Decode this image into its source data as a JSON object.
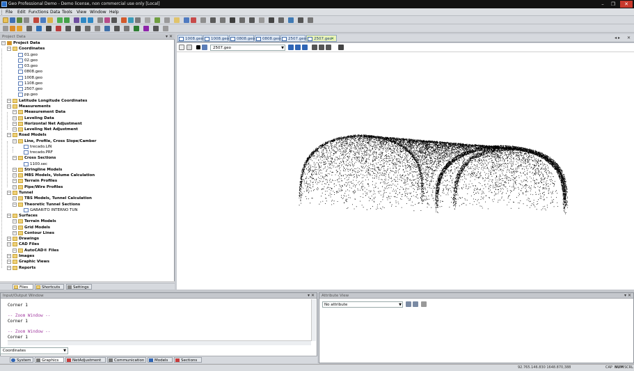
{
  "window": {
    "title": "Geo Professional Demo - Demo license, non commercial use only [Local]",
    "minimize_glyph": "–",
    "restore_glyph": "❐",
    "close_glyph": "✕"
  },
  "menu": [
    "File",
    "Edit",
    "Functions",
    "Data",
    "Tools",
    "View",
    "Window",
    "Help"
  ],
  "project_pane": {
    "title": "Project Data",
    "tree": [
      {
        "label": "Project Data",
        "level": 0,
        "kind": "project",
        "bold": true
      },
      {
        "label": "Coordinates",
        "level": 1,
        "kind": "folder",
        "bold": true
      },
      {
        "label": "01.geo",
        "level": 2,
        "kind": "file"
      },
      {
        "label": "02.geo",
        "level": 2,
        "kind": "file"
      },
      {
        "label": "03.geo",
        "level": 2,
        "kind": "file"
      },
      {
        "label": "0808.geo",
        "level": 2,
        "kind": "file"
      },
      {
        "label": "1008.geo",
        "level": 2,
        "kind": "file"
      },
      {
        "label": "1108.geo",
        "level": 2,
        "kind": "file"
      },
      {
        "label": "2507.geo",
        "level": 2,
        "kind": "file"
      },
      {
        "label": "pp.geo",
        "level": 2,
        "kind": "file"
      },
      {
        "label": "Latitude Longitude Coordinates",
        "level": 1,
        "kind": "folder",
        "bold": true
      },
      {
        "label": "Measurements",
        "level": 1,
        "kind": "folder",
        "bold": true
      },
      {
        "label": "Measurement Data",
        "level": 2,
        "kind": "folder",
        "bold": true
      },
      {
        "label": "Leveling Data",
        "level": 2,
        "kind": "folder",
        "bold": true
      },
      {
        "label": "Horizontal Net Adjustment",
        "level": 2,
        "kind": "folder",
        "bold": true
      },
      {
        "label": "Leveling Net Adjustment",
        "level": 2,
        "kind": "folder",
        "bold": true
      },
      {
        "label": "Road Models",
        "level": 1,
        "kind": "folder",
        "bold": true
      },
      {
        "label": "Line, Profile, Cross Slope/Camber",
        "level": 2,
        "kind": "folder",
        "bold": true
      },
      {
        "label": "trecado.LIN",
        "level": 3,
        "kind": "line"
      },
      {
        "label": "trecado.PRF",
        "level": 3,
        "kind": "profile"
      },
      {
        "label": "Cross Sections",
        "level": 2,
        "kind": "folder",
        "bold": true
      },
      {
        "label": "1100.sec",
        "level": 3,
        "kind": "section"
      },
      {
        "label": "Stringline Models",
        "level": 2,
        "kind": "folder",
        "bold": true
      },
      {
        "label": "MBS Models, Volume Calculation",
        "level": 2,
        "kind": "folder",
        "bold": true
      },
      {
        "label": "Terrain Profiles",
        "level": 2,
        "kind": "folder",
        "bold": true
      },
      {
        "label": "Pipe/Wire Profiles",
        "level": 2,
        "kind": "folder",
        "bold": true
      },
      {
        "label": "Tunnel",
        "level": 1,
        "kind": "folder",
        "bold": true
      },
      {
        "label": "TBS Models, Tunnel Calculation",
        "level": 2,
        "kind": "folder",
        "bold": true
      },
      {
        "label": "Theoretic Tunnel Sections",
        "level": 2,
        "kind": "folder",
        "bold": true
      },
      {
        "label": "GABARITO INTERNO TUN",
        "level": 3,
        "kind": "tunnel"
      },
      {
        "label": "Surfaces",
        "level": 1,
        "kind": "folder",
        "bold": true
      },
      {
        "label": "Terrain Models",
        "level": 2,
        "kind": "folder",
        "bold": true
      },
      {
        "label": "Grid Models",
        "level": 2,
        "kind": "folder",
        "bold": true
      },
      {
        "label": "Contour Lines",
        "level": 2,
        "kind": "folder",
        "bold": true
      },
      {
        "label": "Drawings",
        "level": 1,
        "kind": "folder",
        "bold": true
      },
      {
        "label": "CAD Files",
        "level": 1,
        "kind": "folder",
        "bold": true
      },
      {
        "label": "AutoCAD® Files",
        "level": 2,
        "kind": "folder",
        "bold": true
      },
      {
        "label": "Images",
        "level": 1,
        "kind": "folder",
        "bold": true
      },
      {
        "label": "Graphic Views",
        "level": 1,
        "kind": "folder",
        "bold": true
      },
      {
        "label": "Reports",
        "level": 1,
        "kind": "folder",
        "bold": true
      }
    ],
    "tabs": [
      "Files",
      "Shortcuts",
      "Settings"
    ]
  },
  "doc_tabs": [
    "1008.geo",
    "1008.geo",
    "0808.geo",
    "0808.geo",
    "2507.geo",
    "2507.geo"
  ],
  "graphic_view": {
    "selected_file": "2507.geo"
  },
  "io_window": {
    "title": "Input/Output Window",
    "lines": [
      {
        "text": "Corner 1",
        "kind": "normal"
      },
      {
        "text": "",
        "kind": "normal"
      },
      {
        "text": "-- Zoom Window --",
        "kind": "zoom"
      },
      {
        "text": "Corner 1",
        "kind": "normal"
      },
      {
        "text": "",
        "kind": "normal"
      },
      {
        "text": "-- Zoom Window --",
        "kind": "zoom"
      },
      {
        "text": "Corner 1",
        "kind": "normal"
      }
    ],
    "command_value": "Coordinates",
    "tabs": [
      "System",
      "Graphics",
      "NetAdjustment",
      "Communication",
      "Models",
      "Sections"
    ]
  },
  "attribute_view": {
    "title": "Attribute View",
    "selected": "No attribute"
  },
  "statusbar": {
    "coords": "92.765.146.830   1648.870,388",
    "indicators": [
      "CAP",
      "NUM",
      "SCRL"
    ]
  },
  "colors": {
    "title_bg": "#121212",
    "doc_tab_active": "#eaf4b8",
    "zoom_text": "#a23ca0",
    "point_cloud": "#000000"
  }
}
